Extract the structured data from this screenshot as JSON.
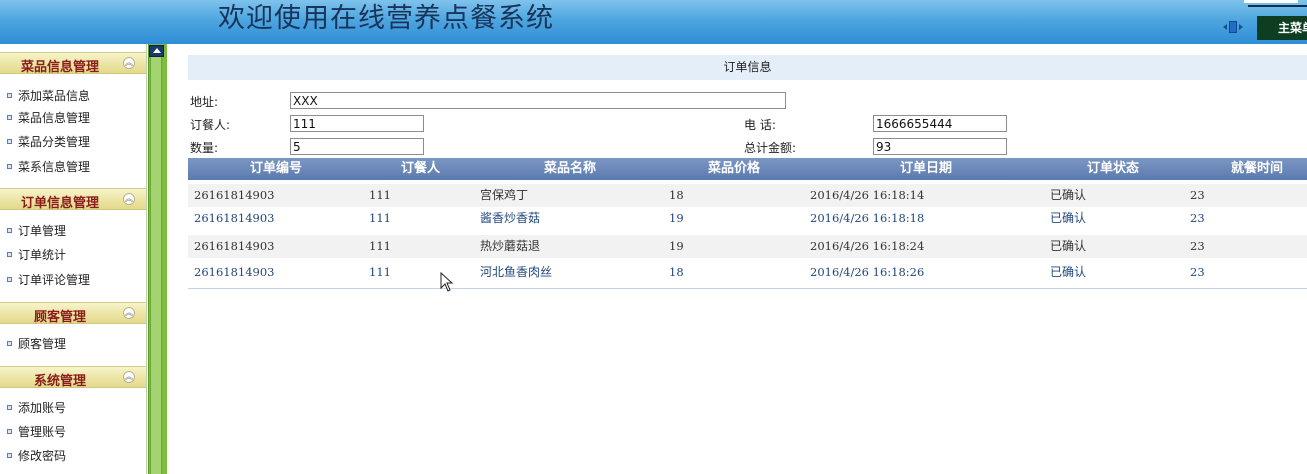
{
  "header": {
    "title": "欢迎使用在线营养点餐系统",
    "main_menu_label": "主菜单"
  },
  "sidebar": {
    "groups": [
      {
        "title": "菜品信息管理",
        "items": [
          "添加菜品信息",
          "菜品信息管理",
          "菜品分类管理",
          "菜系信息管理"
        ]
      },
      {
        "title": "订单信息管理",
        "items": [
          "订单管理",
          "订单统计",
          "订单评论管理"
        ]
      },
      {
        "title": "顾客管理",
        "items": [
          "顾客管理"
        ]
      },
      {
        "title": "系统管理",
        "items": [
          "添加账号",
          "管理账号",
          "修改密码"
        ]
      }
    ]
  },
  "panel": {
    "title": "订单信息"
  },
  "form": {
    "address_label": "地址:",
    "address_value": "XXX",
    "orderer_label": "订餐人:",
    "orderer_value": "111",
    "phone_label": "电 话:",
    "phone_value": "1666655444",
    "quantity_label": "数量:",
    "quantity_value": "5",
    "total_label": "总计金额:",
    "total_value": "93"
  },
  "table": {
    "columns": [
      "订单编号",
      "订餐人",
      "菜品名称",
      "菜品价格",
      "订单日期",
      "订单状态",
      "就餐时间"
    ],
    "rows": [
      [
        "26161814903",
        "111",
        "宫保鸡丁",
        "18",
        "2016/4/26 16:18:14",
        "已确认",
        "23"
      ],
      [
        "26161814903",
        "111",
        "酱香炒香菇",
        "19",
        "2016/4/26 16:18:18",
        "已确认",
        "23"
      ],
      [
        "26161814903",
        "111",
        "热炒蘑菇退",
        "19",
        "2016/4/26 16:18:24",
        "已确认",
        "23"
      ],
      [
        "26161814903",
        "111",
        "河北鱼香肉丝",
        "18",
        "2016/4/26 16:18:26",
        "已确认",
        "23"
      ]
    ]
  }
}
